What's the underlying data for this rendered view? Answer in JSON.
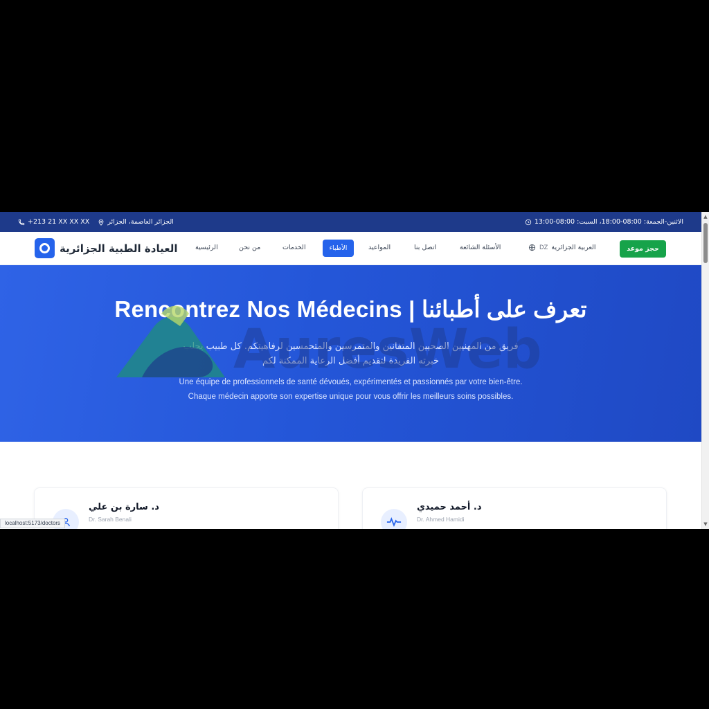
{
  "topbar": {
    "phone": "+213 21 XX XX XX",
    "address": "الجزائر العاصمة، الجزائر",
    "hours": "الاثنين-الجمعة: 08:00-18:00، السبت: 08:00-13:00"
  },
  "brand": {
    "name": "العيادة الطبية الجزائرية"
  },
  "nav": {
    "home": "الرئيسية",
    "about": "من نحن",
    "services": "الخدمات",
    "doctors": "الأطباء",
    "appointments": "المواعيد",
    "contact": "اتصل بنا",
    "faq": "الأسئلة الشائعة",
    "language": "العربية الجزائرية",
    "language_code": "DZ",
    "book_button": "حجز موعد"
  },
  "hero": {
    "title": "Rencontrez Nos Médecins | تعرف على أطبائنا",
    "subtitle_ar_line1": "فريق من المهنيين الصحيين المتفانين والمتمرسين والمتحمسين لرفاهيتكم. كل طبيب يجلب",
    "subtitle_ar_line2": "خبرته الفريدة لتقديم أفضل الرعاية الممكنة لكم",
    "subtitle_fr_line1": "Une équipe de professionnels de santé dévoués, expérimentés et passionnés par votre bien-être.",
    "subtitle_fr_line2": "Chaque médecin apporte son expertise unique pour vous offrir les meilleurs soins possibles."
  },
  "watermark": {
    "text": "AuresWeb"
  },
  "doctors": [
    {
      "name_ar": "د. سارة بن علي",
      "name_fr": "Dr. Sarah Benali",
      "icon": "user-icon"
    },
    {
      "name_ar": "د. أحمد حميدي",
      "name_fr": "Dr. Ahmed Hamidi",
      "icon": "heartbeat-icon"
    }
  ],
  "status_url": "localhost:5173/doctors",
  "colors": {
    "topbar": "#1e3a8a",
    "primary": "#2563eb",
    "book": "#16a34a",
    "hero_start": "#2f63e6",
    "hero_end": "#1f49c4"
  }
}
